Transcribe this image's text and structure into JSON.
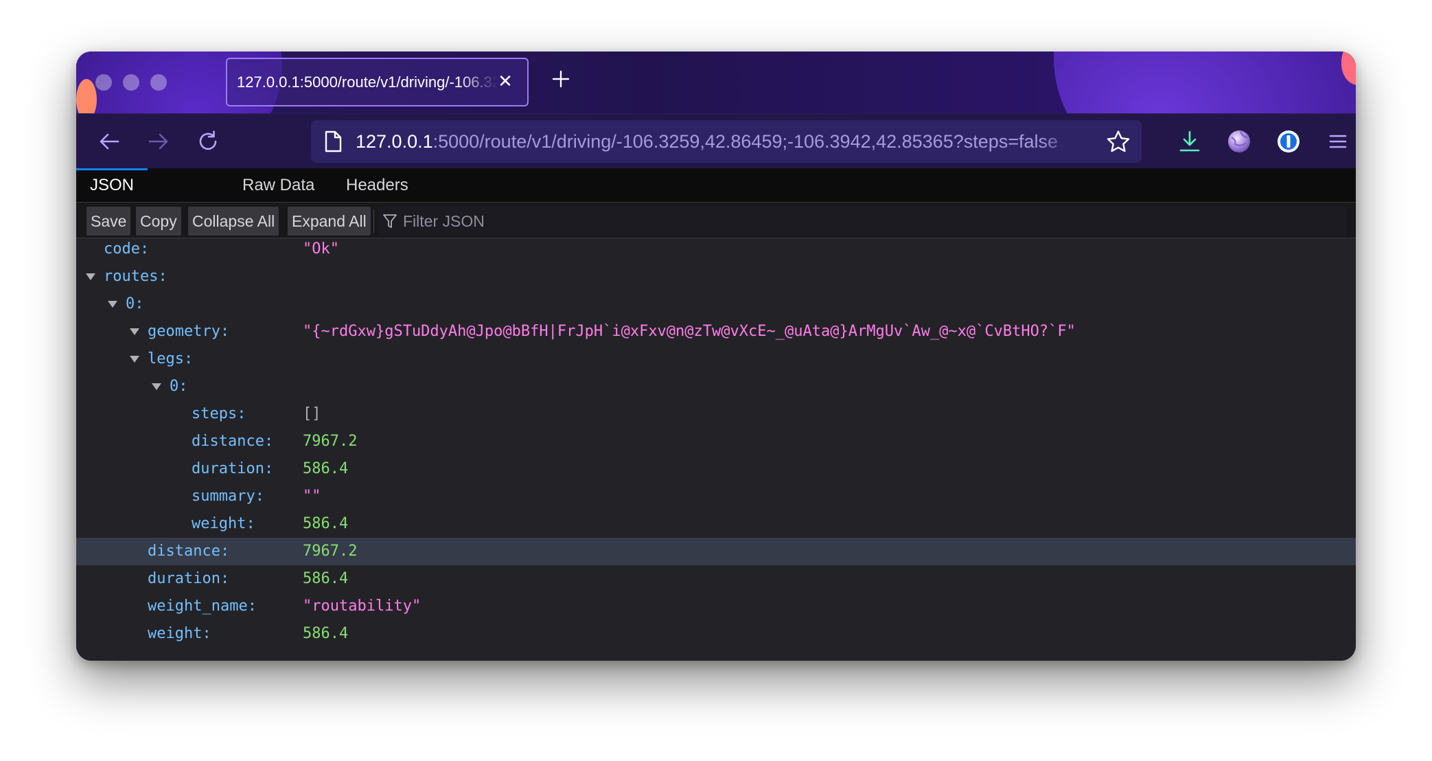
{
  "browser": {
    "tab": {
      "title": "127.0.0.1:5000/route/v1/driving/-106.3259,42.86459;-106.3942,42.85365?steps=false"
    },
    "url": {
      "host": "127.0.0.1",
      "rest": ":5000/route/v1/driving/-106.3259,42.86459;-106.3942,42.85365?steps=false"
    }
  },
  "viewer": {
    "tabs": [
      "JSON",
      "Raw Data",
      "Headers"
    ],
    "toolbar": {
      "save": "Save",
      "copy": "Copy",
      "collapse_all": "Collapse All",
      "expand_all": "Expand All",
      "filter_placeholder": "Filter JSON"
    }
  },
  "json": {
    "code": {
      "key": "code:",
      "value": "\"Ok\""
    },
    "routes": {
      "key": "routes:"
    },
    "route0": {
      "key": "0:"
    },
    "geometry": {
      "key": "geometry:",
      "value": "\"{~rdGxw}gSTuDdyAh@Jpo@bBfH|FrJpH`i@xFxv@n@zTw@vXcE~_@uAta@}ArMgUv`Aw_@~x@`CvBtHO?`F\""
    },
    "legs": {
      "key": "legs:"
    },
    "leg0": {
      "key": "0:"
    },
    "steps": {
      "key": "steps:",
      "value": "[]"
    },
    "leg_distance": {
      "key": "distance:",
      "value": "7967.2"
    },
    "leg_duration": {
      "key": "duration:",
      "value": "586.4"
    },
    "summary": {
      "key": "summary:",
      "value": "\"\""
    },
    "leg_weight": {
      "key": "weight:",
      "value": "586.4"
    },
    "distance": {
      "key": "distance:",
      "value": "7967.2"
    },
    "duration": {
      "key": "duration:",
      "value": "586.4"
    },
    "weight_name": {
      "key": "weight_name:",
      "value": "\"routability\""
    },
    "weight": {
      "key": "weight:",
      "value": "586.4"
    }
  }
}
